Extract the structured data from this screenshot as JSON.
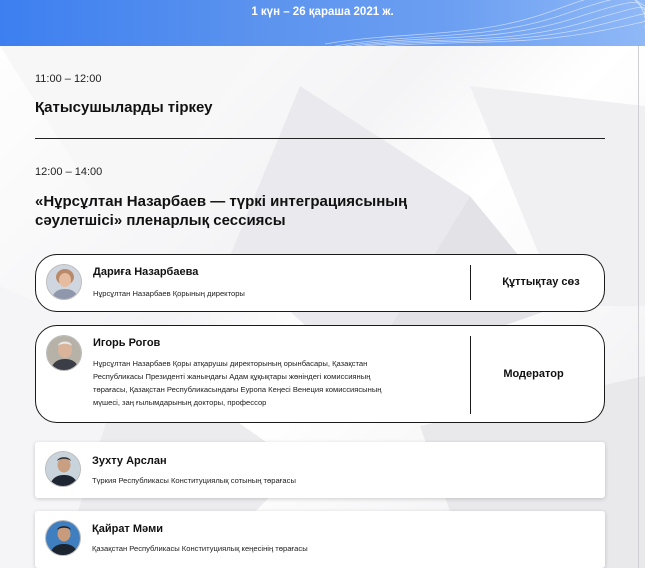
{
  "header": {
    "date": "1 күн – 26 қараша 2021 ж."
  },
  "sessions": [
    {
      "time": "11:00 – 12:00",
      "title": "Қатысушыларды тіркеу"
    },
    {
      "time": "12:00 – 14:00",
      "title_line1": "«Нұрсұлтан Назарбаев — түркі интеграциясының",
      "title_line2": "сәулетшісі» пленарлық сессиясы"
    }
  ],
  "speakers": [
    {
      "name": "Дариға Назарбаева",
      "desc": [
        "Нұрсұлтан Назарбаев Қорының  директоры"
      ],
      "role": "Құттықтау сөз"
    },
    {
      "name": "Игорь Рогов",
      "desc": [
        "Нұрсұлтан Назарбаев Қоры атқарушы директорының орынбасары, Қазақстан",
        "Республикасы Президенті жанындағы Адам құқықтары жөніндегі комиссияның",
        "төрағасы, Қазақстан Республикасындағы Еуропа Кеңесі Венеция комиссиясының",
        "мүшесі, заң ғылымдарының докторы, профессор"
      ],
      "role": "Модератор"
    },
    {
      "name": "Зухту Арслан",
      "desc": [
        "Түркия Республикасы Конституциялық сотының төрағасы"
      ]
    },
    {
      "name": "Қайрат Мәми",
      "desc": [
        "Қазақстан Республикасы Конституциялық кеңесінің төрағасы"
      ]
    }
  ]
}
